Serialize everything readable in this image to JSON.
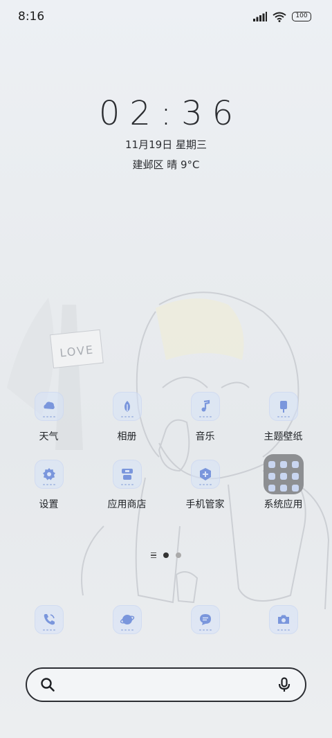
{
  "status_bar": {
    "time": "8:16",
    "battery": "100"
  },
  "clock": {
    "time": "02:36",
    "date": "11月19日 星期三",
    "weather": "建邺区 晴 9°C"
  },
  "apps": [
    {
      "label": "天气",
      "icon": "weather-icon"
    },
    {
      "label": "相册",
      "icon": "gallery-icon"
    },
    {
      "label": "音乐",
      "icon": "music-icon"
    },
    {
      "label": "主题壁纸",
      "icon": "themes-icon"
    },
    {
      "label": "设置",
      "icon": "gear-icon"
    },
    {
      "label": "应用商店",
      "icon": "app-store-icon"
    },
    {
      "label": "手机管家",
      "icon": "security-icon"
    },
    {
      "label": "系统应用",
      "icon": "folder-icon"
    }
  ],
  "dock": [
    {
      "icon": "phone-icon"
    },
    {
      "icon": "browser-icon"
    },
    {
      "icon": "messages-icon"
    },
    {
      "icon": "camera-icon"
    }
  ],
  "page_indicator": {
    "pages": 2,
    "active": 1
  },
  "search": {
    "placeholder": ""
  },
  "wallpaper": {
    "sign_text": "LOVE"
  },
  "colors": {
    "icon_glyph": "#7a96dc",
    "icon_bg": "#d6e2f8"
  }
}
